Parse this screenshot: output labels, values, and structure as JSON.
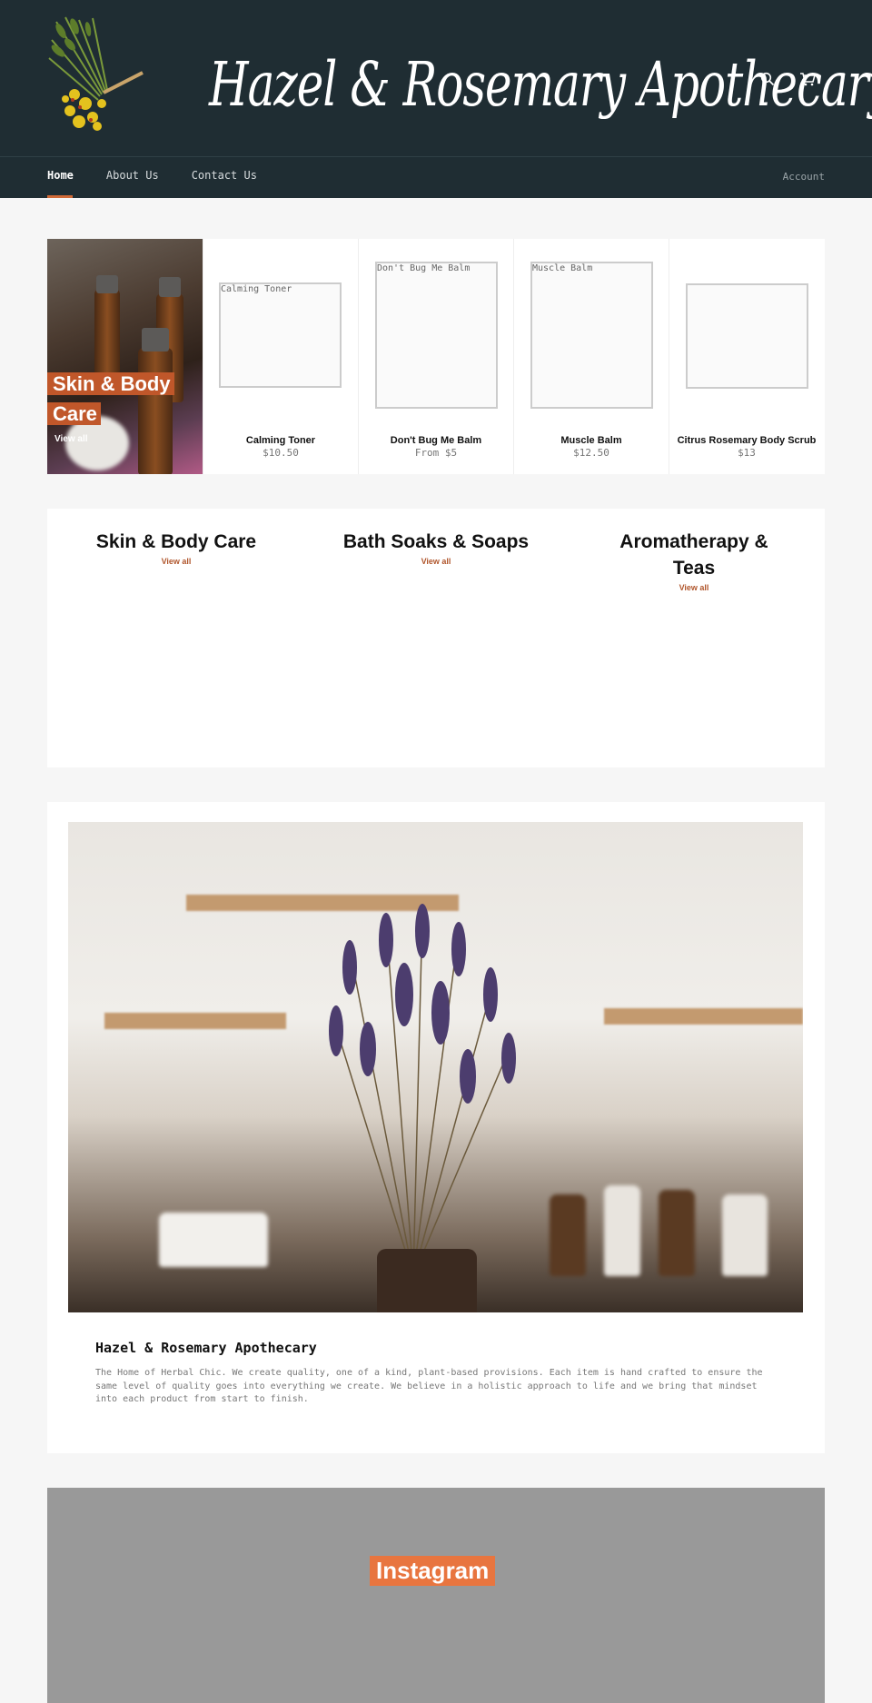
{
  "brand": {
    "name": "Hazel & Rosemary Apothecary"
  },
  "header": {
    "icons": [
      "search-icon",
      "cart-icon"
    ],
    "nav": [
      {
        "label": "Home",
        "active": true
      },
      {
        "label": "About Us",
        "active": false
      },
      {
        "label": "Contact Us",
        "active": false
      }
    ],
    "account_label": "Account"
  },
  "featured": {
    "hero": {
      "title": "Skin & Body Care",
      "link": "View all"
    },
    "products": [
      {
        "name": "Calming Toner",
        "price": "$10.50",
        "image_alt": "Calming Toner"
      },
      {
        "name": "Don't Bug Me Balm",
        "price": "From $5",
        "image_alt": "Don't Bug Me Balm"
      },
      {
        "name": "Muscle Balm",
        "price": "$12.50",
        "image_alt": "Muscle Balm"
      },
      {
        "name": "Citrus Rosemary Body Scrub",
        "price": "$13",
        "image_alt": ""
      }
    ]
  },
  "collections": [
    {
      "title": "Skin & Body Care",
      "link": "View all"
    },
    {
      "title": "Bath Soaks & Soaps",
      "link": "View all"
    },
    {
      "title": "Aromatherapy & Teas",
      "link": "View all"
    }
  ],
  "about": {
    "title": "Hazel & Rosemary Apothecary",
    "text": "The Home of Herbal Chic. We create quality, one of a kind, plant-based provisions. Each item is hand crafted to ensure the same level of quality goes into  everything we create. We believe in a holistic approach to life and we bring that mindset into each product from start to finish."
  },
  "instagram": {
    "label": "Instagram"
  },
  "colors": {
    "header_bg": "#1f2d33",
    "accent": "#d06a37",
    "page_bg": "#f6f6f6",
    "instagram_bg": "#999999"
  }
}
